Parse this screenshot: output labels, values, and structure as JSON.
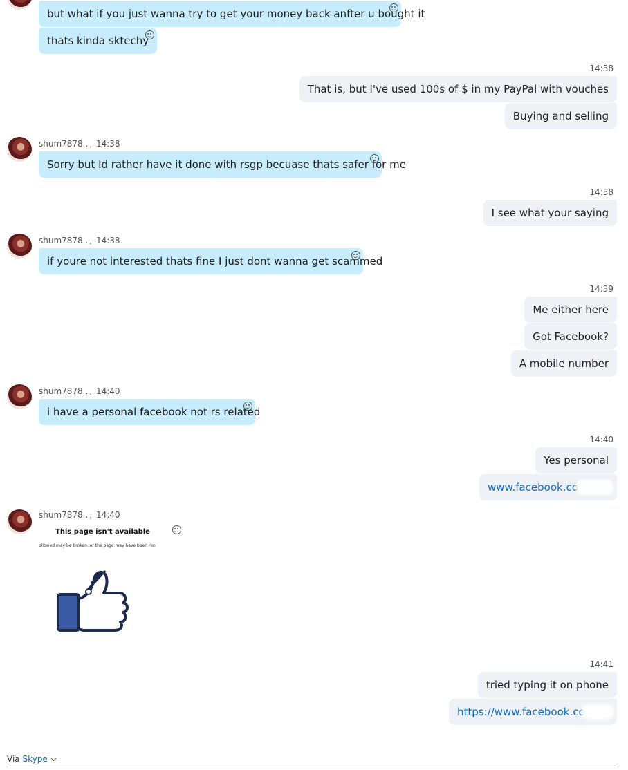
{
  "conversation": {
    "contact_name": "shum7878 .",
    "meta_separator": ",",
    "blocks": [
      {
        "messages": [
          "but what if you just wanna try to get your money back anfter u bought it",
          "thats kinda sktechy"
        ]
      },
      {
        "time": "14:38",
        "messages": [
          "That is, but I've used 100s of $ in my PayPal with vouches",
          "Buying and selling"
        ]
      },
      {
        "time": "14:38",
        "messages": [
          "Sorry but Id rather have it done with rsgp becuase thats safer for me"
        ]
      },
      {
        "time": "14:38",
        "messages": [
          "I see what your saying"
        ]
      },
      {
        "time": "14:38",
        "messages": [
          "if youre not interested thats fine I just dont wanna get scammed"
        ]
      },
      {
        "time": "14:39",
        "messages": [
          "Me either here",
          "Got Facebook?",
          "A mobile number"
        ]
      },
      {
        "time": "14:40",
        "messages": [
          "i have a personal facebook not rs related"
        ]
      },
      {
        "time": "14:40",
        "messages": [
          "Yes personal",
          "www.facebook.com"
        ]
      },
      {
        "time": "14:40",
        "preview": {
          "title": "This page isn't available",
          "subtitle": "ollowed may be broken, or the page may have been ren"
        }
      },
      {
        "time": "14:41",
        "messages": [
          "tried typing it on phone",
          "https://www.facebook.com/"
        ]
      }
    ]
  },
  "footer": {
    "via_label": "Via",
    "source_label": "Skype"
  },
  "colors": {
    "incoming_bubble": "#c7ecfb",
    "outgoing_bubble": "#eef1f6",
    "link": "#0f6cbd",
    "facebook_blue": "#3b5aa6"
  },
  "icons": {
    "reaction": "smiley-icon",
    "avatar": "contact-avatar",
    "dropdown": "chevron-down-icon",
    "preview_image": "broken-thumbs-up-icon"
  }
}
